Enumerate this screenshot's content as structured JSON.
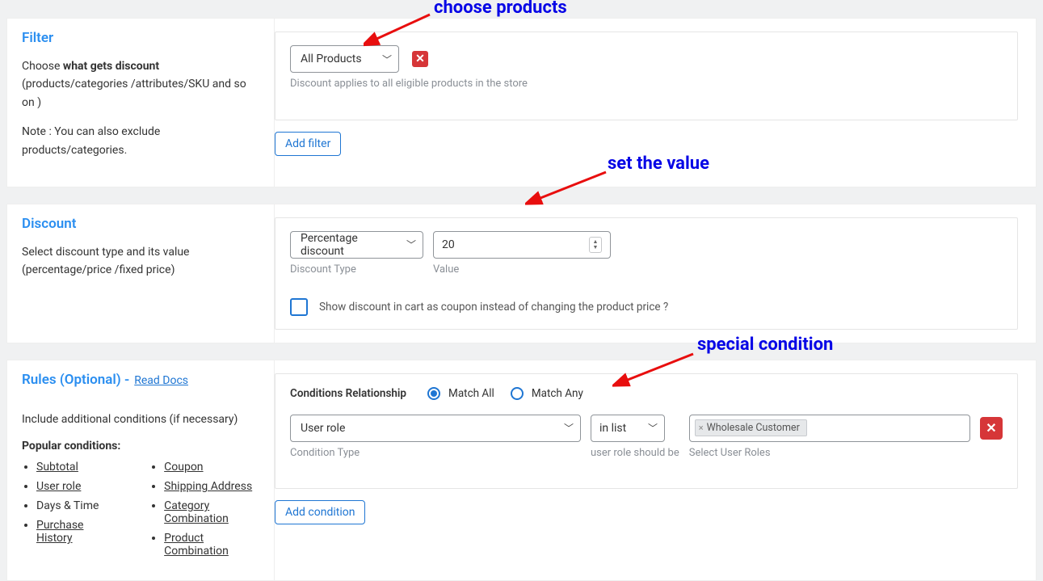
{
  "annotations": {
    "choose_products": "choose products",
    "set_value": "set the value",
    "special_condition": "special condition"
  },
  "filter": {
    "title": "Filter",
    "desc_prefix": "Choose ",
    "desc_bold": "what gets discount",
    "desc_suffix": " (products/categories /attributes/SKU and so on )",
    "note": "Note : You can also exclude products/categories.",
    "select_value": "All Products",
    "helper": "Discount applies to all eligible products in the store",
    "add_button": "Add filter"
  },
  "discount": {
    "title": "Discount",
    "desc": "Select discount type and its value (percentage/price /fixed price)",
    "type_label": "Discount Type",
    "type_value": "Percentage discount",
    "value_label": "Value",
    "value": "20",
    "checkbox_label": "Show discount in cart as coupon instead of changing the product price ?"
  },
  "rules": {
    "title": "Rules (Optional) -",
    "read_docs": "Read Docs",
    "desc": "Include additional conditions (if necessary)",
    "popular_heading": "Popular conditions:",
    "popular_col1": [
      "Subtotal",
      "User role",
      "Days & Time",
      "Purchase History"
    ],
    "popular_col2": [
      "Coupon",
      "Shipping Address",
      "Category Combination",
      "Product Combination"
    ],
    "relationship_label": "Conditions Relationship",
    "match_all": "Match All",
    "match_any": "Match Any",
    "condition_type_label": "Condition Type",
    "condition_type_value": "User role",
    "operator_value": "in list",
    "operator_helper": "user role should be",
    "roles_helper": "Select User Roles",
    "tag": "Wholesale Customer",
    "add_button": "Add condition"
  }
}
